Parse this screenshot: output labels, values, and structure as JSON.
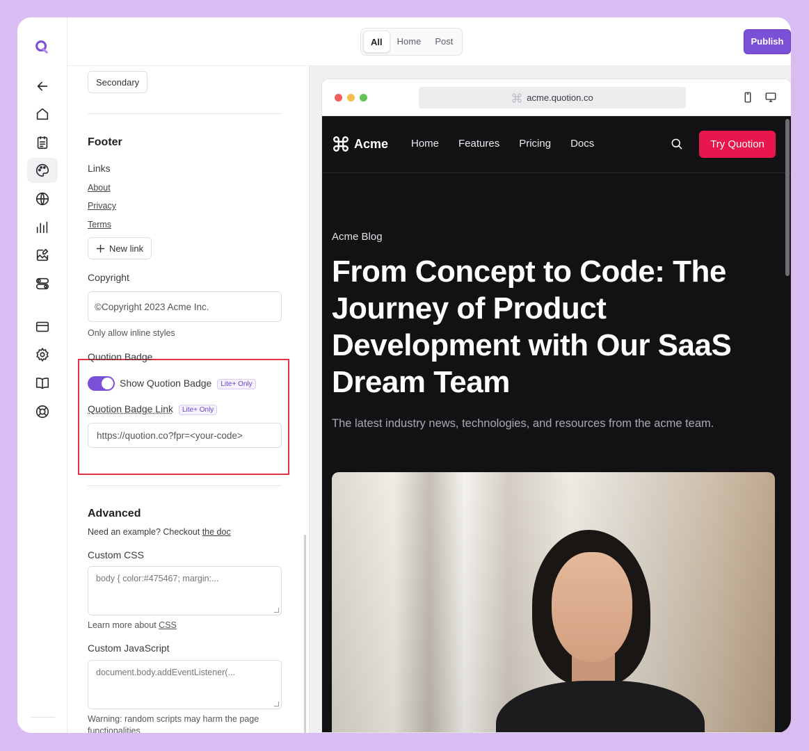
{
  "topbar": {
    "tabs": [
      {
        "label": "All",
        "active": true
      },
      {
        "label": "Home",
        "active": false
      },
      {
        "label": "Post",
        "active": false
      }
    ],
    "publish_label": "Publish"
  },
  "rail": {
    "icons": [
      "logo-icon",
      "back-arrow-icon",
      "home-icon",
      "document-icon",
      "palette-icon",
      "globe-icon",
      "chart-bars-icon",
      "image-edit-icon",
      "toggles-icon",
      "credit-card-icon",
      "gear-icon",
      "book-icon",
      "lifebuoy-icon"
    ],
    "active": "palette-icon",
    "accent": "#7b4fd6"
  },
  "panel": {
    "secondary_button": "Secondary",
    "footer": {
      "heading": "Footer",
      "links_label": "Links",
      "links": [
        "About",
        "Privacy",
        "Terms"
      ],
      "new_link_label": "New link",
      "copyright_label": "Copyright",
      "copyright_value": "©Copyright 2023 Acme Inc.",
      "copyright_hint": "Only allow inline styles"
    },
    "badge": {
      "heading": "Quotion Badge",
      "toggle_label": "Show Quotion Badge",
      "toggle_on": true,
      "tier_pill": "Lite+ Only",
      "link_label": "Quotion Badge Link",
      "link_placeholder": "https://quotion.co?fpr=<your-code>",
      "highlight_color": "#e33242"
    },
    "advanced": {
      "heading": "Advanced",
      "intro_text": "Need an example? Checkout",
      "intro_link": "the doc",
      "css_label": "Custom CSS",
      "css_placeholder": "body { color:#475467; margin:...",
      "css_hint_text": "Learn more about",
      "css_hint_link": "CSS",
      "js_label": "Custom JavaScript",
      "js_placeholder": "document.body.addEventListener(...",
      "js_warning": "Warning: random scripts may harm the page functionalities"
    }
  },
  "preview": {
    "url": "acme.quotion.co",
    "site": {
      "brand": "Acme",
      "nav": [
        "Home",
        "Features",
        "Pricing",
        "Docs"
      ],
      "cta": "Try Quotion",
      "cta_color": "#e8164c",
      "eyebrow": "Acme Blog",
      "headline": "From Concept to Code: The Journey of Product Development with Our SaaS Dream Team",
      "subtitle": "The latest industry news, technologies, and resources from the acme team."
    }
  }
}
